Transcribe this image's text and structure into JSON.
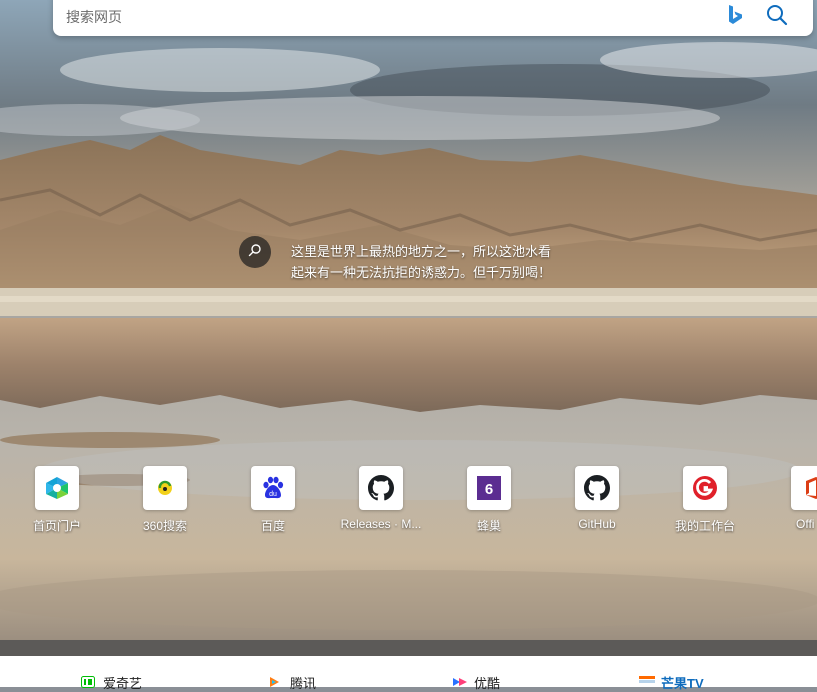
{
  "search": {
    "placeholder": "搜索网页"
  },
  "caption": {
    "text": "这里是世界上最热的地方之一，所以这池水看起来有一种无法抗拒的诱惑力。但千万别喝！"
  },
  "quick_links": [
    {
      "label": "首页门户",
      "icon": "portal-icon"
    },
    {
      "label": "360搜索",
      "icon": "360-search-icon"
    },
    {
      "label": "百度",
      "icon": "baidu-paw-icon"
    },
    {
      "label": "Releases · M...",
      "icon": "github-icon"
    },
    {
      "label": "蜂巢",
      "icon": "fengchao-6-icon"
    },
    {
      "label": "GitHub",
      "icon": "github-icon"
    },
    {
      "label": "我的工作台",
      "icon": "red-g-icon"
    },
    {
      "label": "Offi",
      "icon": "office-icon"
    }
  ],
  "feed_tabs": [
    {
      "label": "爱奇艺",
      "icon": "iqiyi-icon"
    },
    {
      "label": "腾讯",
      "icon": "tencent-video-icon"
    },
    {
      "label": "优酷",
      "icon": "youku-icon"
    },
    {
      "label": "芒果TV",
      "icon": "mango-tv-icon",
      "active": true
    }
  ],
  "colors": {
    "accent": "#0f6cbd",
    "fengchao": "#5b2d91",
    "red_g": "#e0202a"
  }
}
